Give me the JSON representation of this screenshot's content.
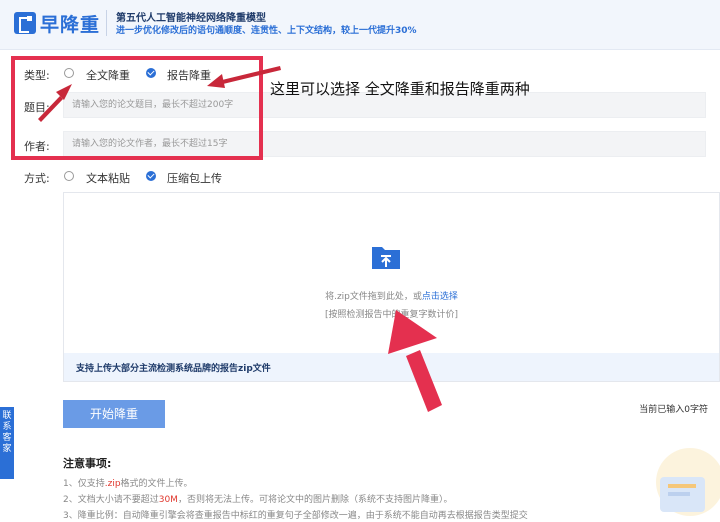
{
  "header": {
    "logo": "早降重",
    "slogan_line1": "第五代人工智能神经网络降重模型",
    "slogan_line2": "进一步优化修改后的语句通顺度、连贯性、上下文结构，较上一代提升30%"
  },
  "form": {
    "type_label": "类型:",
    "type_options": [
      "全文降重",
      "报告降重"
    ],
    "title_label": "题目:",
    "title_placeholder": "请输入您的论文题目，最长不超过200字",
    "author_label": "作者:",
    "author_placeholder": "请输入您的论文作者，最长不超过15字",
    "mode_label": "方式:",
    "mode_options": [
      "文本粘贴",
      "压缩包上传"
    ]
  },
  "upload": {
    "drop_hint": "将.zip文件拖到此处，或",
    "drop_link": "点击选择",
    "price_hint": "[按照检测报告中的重复字数计价]",
    "footer": "支持上传大部分主流检测系统品牌的报告zip文件"
  },
  "start_button": "开始降重",
  "char_count": "当前已输入0字符",
  "notes": {
    "title": "注意事项:",
    "items": [
      {
        "prefix": "1、仅支持",
        "highlight": ".zip",
        "suffix": "格式的文件上传。"
      },
      {
        "prefix": "2、文档大小请不要超过",
        "highlight": "30M",
        "suffix": "，否则将无法上传。可将论文中的图片删除（系统不支持图片降重）。"
      },
      {
        "prefix": "3、降重比例：自动降重引擎会将查重报告中标红的重复句子全部修改一遍，由于系统不能自动再去根据报告类型提交",
        "highlight": "",
        "suffix": ""
      }
    ]
  },
  "side_tab": "联系客家",
  "annotation": "这里可以选择 全文降重和报告降重两种",
  "colors": {
    "accent": "#2b6fd6",
    "annotation": "#e4304f"
  }
}
